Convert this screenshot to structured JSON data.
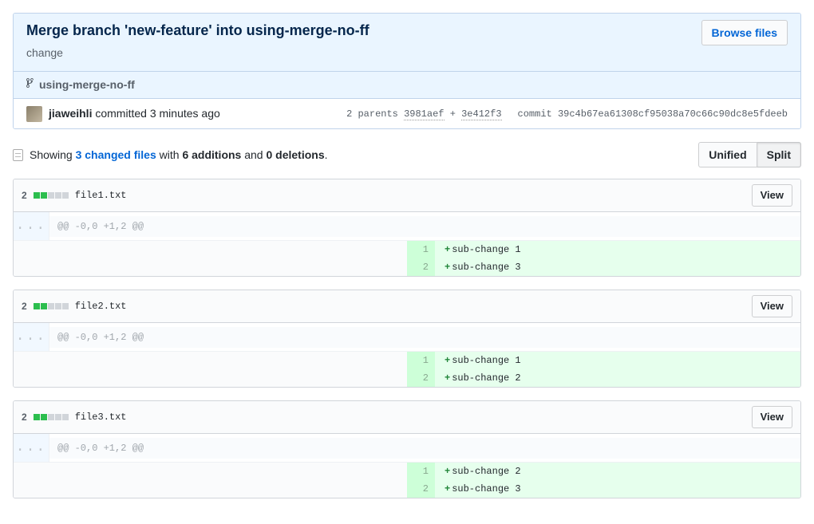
{
  "commit": {
    "title": "Merge branch 'new-feature' into using-merge-no-ff",
    "description": "change",
    "browse_files_label": "Browse files",
    "branch_name": "using-merge-no-ff",
    "author": "jiaweihli",
    "committed_word": "committed",
    "relative_time": "3 minutes ago",
    "parents_label": "2 parents",
    "parent_sha1": "3981aef",
    "parent_sha2": "3e412f3",
    "plus": " + ",
    "commit_label": "commit",
    "full_sha": "39c4b67ea61308cf95038a70c66c90dc8e5fdeeb"
  },
  "summary": {
    "showing": "Showing ",
    "files_link": "3 changed files",
    "with": " with ",
    "additions": "6 additions",
    "and": " and ",
    "deletions": "0 deletions",
    "dot": ".",
    "unified_label": "Unified",
    "split_label": "Split"
  },
  "common": {
    "hunk": "@@ -0,0 +1,2 @@",
    "view_label": "View",
    "ellipsis": "..."
  },
  "files": [
    {
      "count": "2",
      "name": "file1.txt",
      "lines": [
        {
          "num": "1",
          "text": "sub-change 1"
        },
        {
          "num": "2",
          "text": "sub-change 3"
        }
      ]
    },
    {
      "count": "2",
      "name": "file2.txt",
      "lines": [
        {
          "num": "1",
          "text": "sub-change 1"
        },
        {
          "num": "2",
          "text": "sub-change 2"
        }
      ]
    },
    {
      "count": "2",
      "name": "file3.txt",
      "lines": [
        {
          "num": "1",
          "text": "sub-change 2"
        },
        {
          "num": "2",
          "text": "sub-change 3"
        }
      ]
    }
  ]
}
